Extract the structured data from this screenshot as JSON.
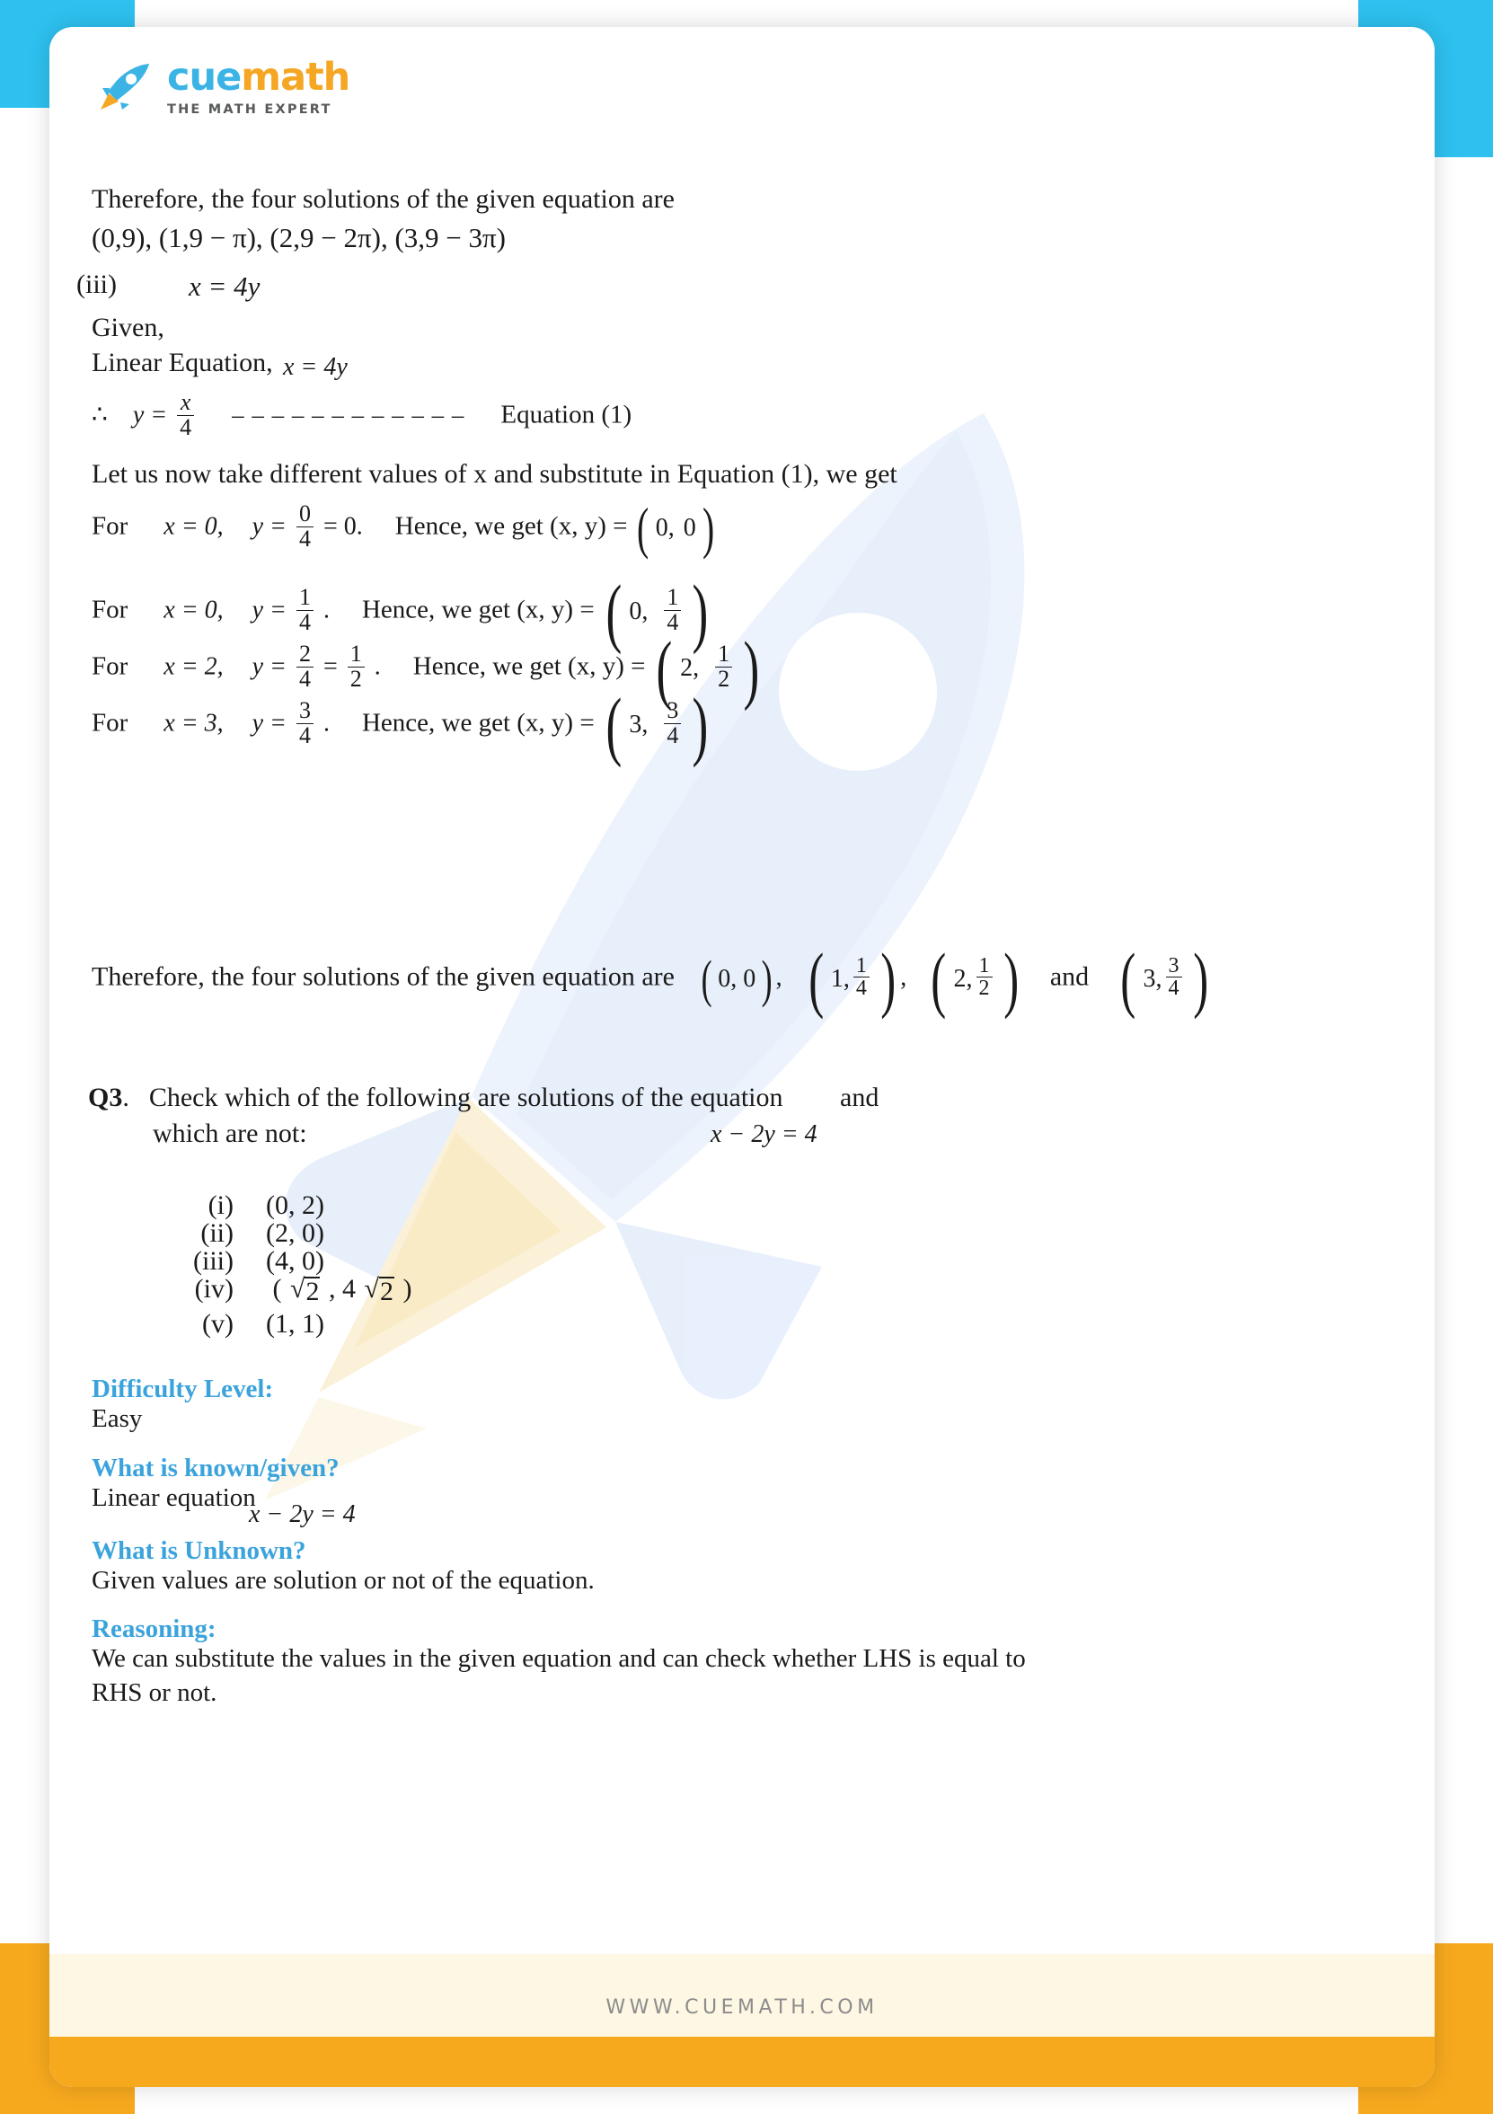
{
  "brand": {
    "name_part1": "cue",
    "name_part2": "math",
    "tagline": "THE MATH EXPERT",
    "logo_icon": "rocket-icon",
    "blue": "#3BB4E5",
    "orange": "#F5A623"
  },
  "colors": {
    "heading_blue": "#3BA3DC",
    "corner_blue": "#2EC1F0",
    "corner_orange": "#F7A91E",
    "footer_band": "#FDF7E3"
  },
  "solution_prev": {
    "conclusion_text": "Therefore, the four solutions of the given equation are",
    "solutions_line": "(0,9),  (1,9 − π),  (2,9 − 2π),  (3,9 − 3π)"
  },
  "part3": {
    "label": "(iii)",
    "equation": "x = 4y",
    "given_label": "Given,",
    "linear_label": "Linear Equation,",
    "linear_equation": "x = 4y",
    "therefore_symbol": "∴",
    "y_equals": "y =",
    "frac_num": "x",
    "frac_den": "4",
    "dashes": "– – – – – – – – – – – –",
    "equation_tag": "Equation (1)",
    "instruction": "Let us now take different values of x and substitute in Equation (1), we get",
    "rows": [
      {
        "for": "For",
        "x": "x = 0,",
        "y_label": "y =",
        "num": "0",
        "den": "4",
        "equals_value": "= 0.",
        "hence": "Hence, we get (x, y) =",
        "pair_x": "0,",
        "pair_y": "0",
        "pair_is_fraction": false
      },
      {
        "for": "For",
        "x": "x = 0,",
        "y_label": "y =",
        "num": "1",
        "den": "4",
        "equals_value": ".",
        "hence": "Hence, we get (x, y) =",
        "pair_x": "0,",
        "pair_y_num": "1",
        "pair_y_den": "4",
        "pair_is_fraction": true
      },
      {
        "for": "For",
        "x": "x = 2,",
        "y_label": "y =",
        "num": "2",
        "den": "4",
        "num2": "1",
        "den2": "2",
        "equals_value": ".",
        "hence": "Hence, we get (x, y) =",
        "pair_x": "2,",
        "pair_y_num": "1",
        "pair_y_den": "2",
        "pair_is_fraction": true
      },
      {
        "for": "For",
        "x": "x = 3,",
        "y_label": "y =",
        "num": "3",
        "den": "4",
        "equals_value": ".",
        "hence": "Hence, we get (x, y) =",
        "pair_x": "3,",
        "pair_y_num": "3",
        "pair_y_den": "4",
        "pair_is_fraction": true
      }
    ],
    "final_text": "Therefore, the four solutions of the given equation are",
    "final_pair1": "(0, 0),",
    "final_pair2_x": "1,",
    "final_pair2_num": "1",
    "final_pair2_den": "4",
    "final_pair3_x": "2,",
    "final_pair3_num": "1",
    "final_pair3_den": "2",
    "final_and": "and",
    "final_pair4_x": "3,",
    "final_pair4_num": "3",
    "final_pair4_den": "4",
    "comma_after_p2": ",",
    "comma_after_p3": ""
  },
  "q3": {
    "number": "Q3",
    "period": ".",
    "text_line1": "Check which of the following are solutions of the equation",
    "equation": "x − 2y = 4",
    "and_word": "and",
    "text_line2": "which are not:",
    "items": [
      {
        "numeral": "(i)",
        "value": "(0, 2)",
        "has_sqrt": false
      },
      {
        "numeral": "(ii)",
        "value": "(2, 0)",
        "has_sqrt": false
      },
      {
        "numeral": "(iii)",
        "value": "(4, 0)",
        "has_sqrt": false
      },
      {
        "numeral": "(iv)",
        "value": "( √2, 4 √2 )",
        "has_sqrt": true,
        "open": "(",
        "sqrt1": "2",
        "mid": ", 4",
        "sqrt2": "2",
        "close": ")"
      },
      {
        "numeral": "(v)",
        "value": "(1, 1)",
        "has_sqrt": false
      }
    ]
  },
  "sections": [
    {
      "heading": "Difficulty Level:",
      "body": "Easy"
    },
    {
      "heading": "What is known/given?",
      "body": "Linear equation",
      "equation": "x − 2y = 4"
    },
    {
      "heading": "What is Unknown?",
      "body": "Given values are solution or not of the equation."
    },
    {
      "heading": "Reasoning:",
      "body": "We can substitute the values in the given equation and can check whether LHS is equal to",
      "body2": "RHS or not."
    }
  ],
  "footer": {
    "url": "WWW.CUEMATH.COM"
  }
}
